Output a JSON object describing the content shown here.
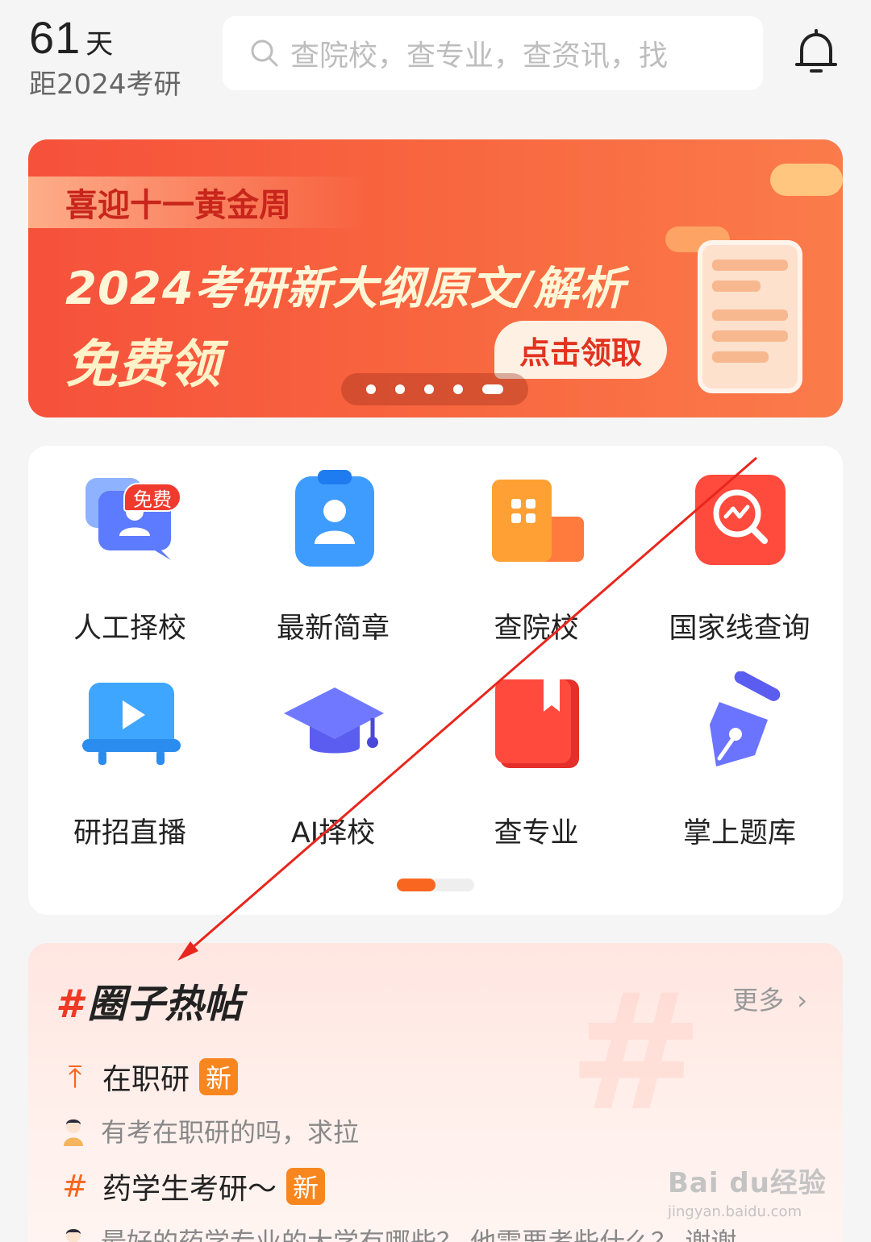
{
  "header": {
    "countdown_days": "61",
    "countdown_unit": "天",
    "countdown_caption": "距2024考研",
    "search_placeholder": "查院校，查专业，查资讯，找",
    "icons": {
      "search": "search-icon",
      "notification": "bell-icon"
    }
  },
  "banner": {
    "tag": "喜迎十一黄金周",
    "title": "2024考研新大纲原文/解析",
    "subtitle": "免费领",
    "cta": "点击领取",
    "carousel_total": 5,
    "carousel_active": 5
  },
  "shortcuts": {
    "items": [
      {
        "label": "人工择校",
        "icon": "chat-advisor-icon",
        "badge": "免费"
      },
      {
        "label": "最新简章",
        "icon": "badge-id-icon"
      },
      {
        "label": "查院校",
        "icon": "building-icon"
      },
      {
        "label": "国家线查询",
        "icon": "chart-search-icon"
      },
      {
        "label": "研招直播",
        "icon": "live-tv-icon"
      },
      {
        "label": "AI择校",
        "icon": "graduation-cap-icon"
      },
      {
        "label": "查专业",
        "icon": "book-icon"
      },
      {
        "label": "掌上题库",
        "icon": "pen-icon"
      }
    ],
    "page_total": 2,
    "page_active": 1
  },
  "hot_posts": {
    "title": "圈子热帖",
    "hash": "#",
    "more": "更多",
    "posts": [
      {
        "icon": "top-arrow-icon",
        "icon_glyph": "⤒",
        "topic": "在职研",
        "tag": "新",
        "text": "有考在职研的吗，求拉"
      },
      {
        "icon": "hash-icon",
        "icon_glyph": "#",
        "topic": "药学生考研～",
        "tag": "新",
        "text": "最好的药学专业的大学有哪些？ 他需要考些什么？ 谢谢"
      }
    ]
  },
  "watermark": {
    "brand": "Bai du经验",
    "url": "jingyan.baidu.com"
  },
  "colors": {
    "accent": "#f8661f",
    "banner_red": "#f6513b",
    "arrow": "#e8261d"
  }
}
